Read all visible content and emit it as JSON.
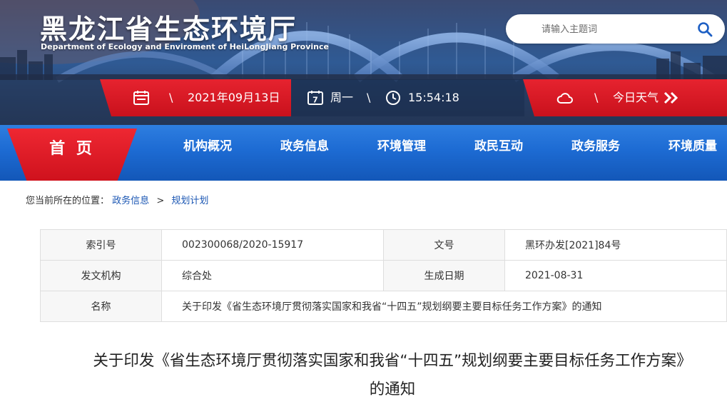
{
  "header": {
    "site_title": "黑龙江省生态环境厅",
    "site_subtitle": "Department of Ecology and Enviroment of HeiLongJiang Province",
    "search": {
      "placeholder": "请输入主题词"
    }
  },
  "info_bar": {
    "date": "2021年09月13日",
    "weekday": "周一",
    "time": "15:54:18",
    "weather_label": "今日天气",
    "separator": "\\",
    "calendar_day": "7"
  },
  "nav": {
    "home": "首 页",
    "items": [
      "机构概况",
      "政务信息",
      "环境管理",
      "政民互动",
      "政务服务",
      "环境质量"
    ]
  },
  "breadcrumb": {
    "prefix": "您当前所在的位置：",
    "items": [
      "政务信息",
      "规划计划"
    ],
    "separator": ">"
  },
  "meta": {
    "index_label": "索引号",
    "index_value": "002300068/2020-15917",
    "doc_no_label": "文号",
    "doc_no_value": "黑环办发[2021]84号",
    "issuer_label": "发文机构",
    "issuer_value": "综合处",
    "date_label": "生成日期",
    "date_value": "2021-08-31",
    "name_label": "名称",
    "name_value": "关于印发《省生态环境厅贯彻落实国家和我省“十四五”规划纲要主要目标任务工作方案》的通知"
  },
  "article": {
    "title_line1": "关于印发《省生态环境厅贯彻落实国家和我省“十四五”规划纲要主要目标任务工作方案》",
    "title_line2": "的通知"
  },
  "colors": {
    "brand_red": "#e6232f",
    "nav_blue": "#1d6bd3",
    "link_blue": "#1a56b3"
  },
  "icons": [
    "search-icon",
    "calendar-icon",
    "calendar-day-icon",
    "clock-icon",
    "cloud-icon",
    "double-chevron-right-icon"
  ]
}
